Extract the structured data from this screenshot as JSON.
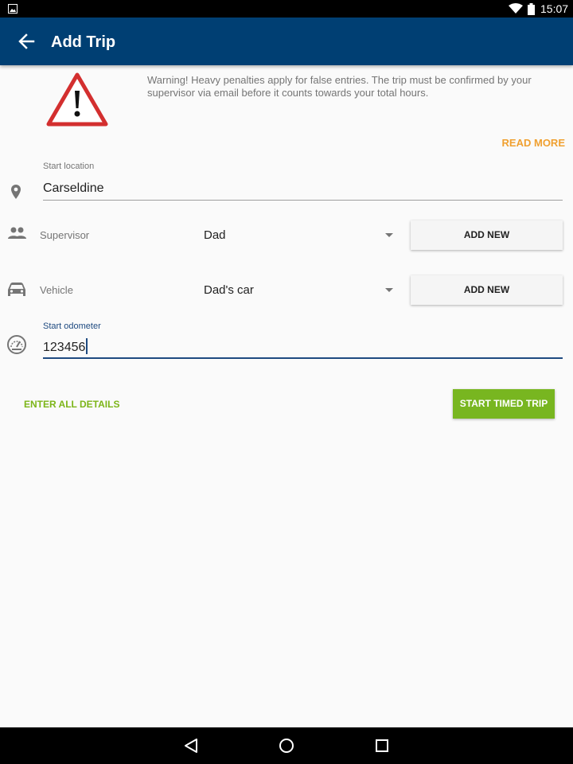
{
  "status_bar": {
    "time": "15:07"
  },
  "app_bar": {
    "title": "Add Trip"
  },
  "warning": {
    "text": "Warning! Heavy penalties apply for false entries. The trip must be confirmed by your supervisor via email before it counts towards your total hours.",
    "read_more": "READ MORE"
  },
  "start_location": {
    "label": "Start location",
    "value": "Carseldine"
  },
  "supervisor": {
    "label": "Supervisor",
    "selected": "Dad",
    "add_button": "ADD NEW"
  },
  "vehicle": {
    "label": "Vehicle",
    "selected": "Dad's car",
    "add_button": "ADD NEW"
  },
  "start_odometer": {
    "label": "Start odometer",
    "value": "123456"
  },
  "actions": {
    "enter_details": "ENTER ALL DETAILS",
    "start_timed_trip": "START TIMED TRIP"
  },
  "colors": {
    "app_bar": "#003f73",
    "accent_orange": "#f0a030",
    "accent_green": "#78b620",
    "focus_blue": "#1e4a80"
  },
  "icons": [
    "image-icon",
    "wifi-icon",
    "battery-icon",
    "back-arrow-icon",
    "warning-triangle-icon",
    "location-pin-icon",
    "people-icon",
    "car-icon",
    "speedometer-icon",
    "nav-back-icon",
    "nav-home-icon",
    "nav-recents-icon"
  ]
}
